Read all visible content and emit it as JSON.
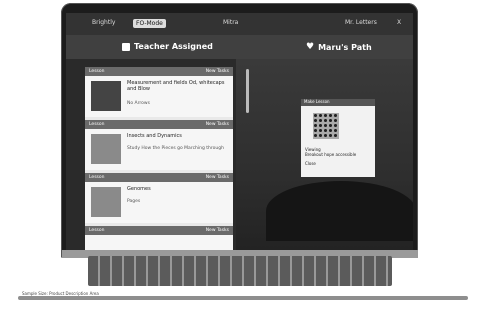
{
  "topbar": {
    "left_item": "Brightly",
    "pill": "FO-Mode",
    "center_app": "Mitra",
    "right_item": "Mr. Letters",
    "close": "X"
  },
  "tabs": {
    "left": "Teacher Assigned",
    "right": "Maru's Path"
  },
  "cards": [
    {
      "head_left": "Lesson",
      "head_right": "New Tasks",
      "title": "Measurement and fields Od, whitecaps and Blow",
      "sub": "No Arrows"
    },
    {
      "head_left": "Lesson",
      "head_right": "New Tasks",
      "title": "Insects and Dynamics",
      "sub": "Study How the Pieces go Marching through"
    },
    {
      "head_left": "Lesson",
      "head_right": "New Tasks",
      "title": "Genomes",
      "sub": "Pages"
    },
    {
      "head_left": "Lesson",
      "head_right": "New Tasks",
      "title": "",
      "sub": ""
    }
  ],
  "popup": {
    "head": "Make Lesson",
    "text1": "Viewing",
    "text2": "Breakout hope accessible",
    "text3": "Close"
  },
  "footer": {
    "left": "Sample Size: Product Description Area",
    "right": ""
  }
}
